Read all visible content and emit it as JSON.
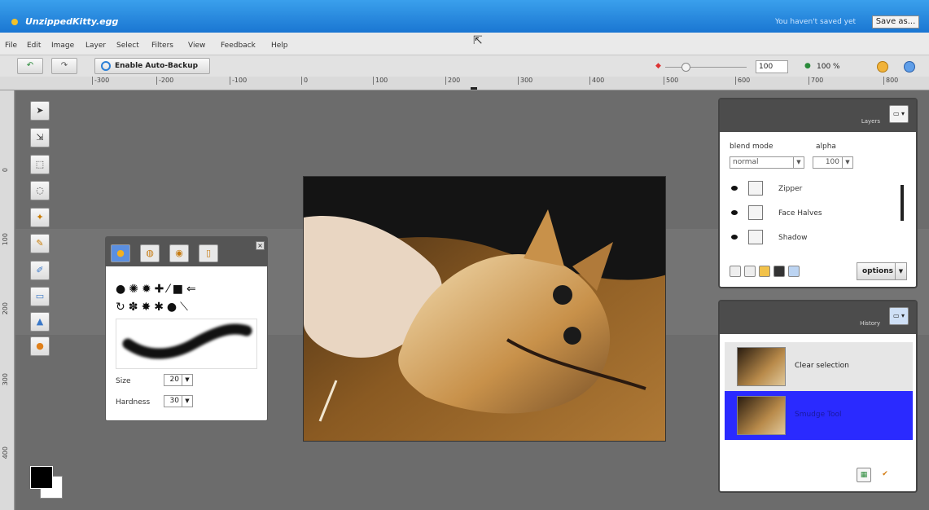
{
  "titlebar": {
    "title": "UnzippedKitty.egg",
    "not_saved": "You haven't saved yet",
    "save_as": "Save as..."
  },
  "menu": [
    "File",
    "Edit",
    "Image",
    "Layer",
    "Select",
    "Filters",
    "View",
    "Feedback",
    "Help"
  ],
  "toolbar": {
    "undo_icon": "undo-icon",
    "redo_icon": "redo-icon",
    "auto_backup": "Enable Auto-Backup",
    "zoom_value": "100",
    "zoom_percent": "100 %"
  },
  "ruler": {
    "top_ticks": [
      "-300",
      "-200",
      "-100",
      "0",
      "100",
      "200",
      "300",
      "400",
      "500",
      "600",
      "700",
      "800"
    ],
    "left_ticks": [
      "0",
      "100",
      "200",
      "300",
      "400"
    ]
  },
  "tools": [
    "move-icon",
    "pointer-icon",
    "marquee-icon",
    "lasso-icon",
    "wand-icon",
    "pencil-icon",
    "brush-icon",
    "eraser-icon",
    "fill-icon",
    "gradient-icon"
  ],
  "brush_panel": {
    "size_label": "Size",
    "size_value": "20",
    "hardness_label": "Hardness",
    "hardness_value": "30"
  },
  "layers": {
    "title": "Layers",
    "blend_label": "blend mode",
    "alpha_label": "alpha",
    "blend_value": "normal",
    "alpha_value": "100",
    "items": [
      {
        "name": "Zipper"
      },
      {
        "name": "Face Halves"
      },
      {
        "name": "Shadow"
      }
    ],
    "options_label": "options"
  },
  "history": {
    "title": "History",
    "items": [
      {
        "name": "Clear selection"
      },
      {
        "name": "Smudge Tool"
      }
    ]
  },
  "colors": {
    "titlebar": "#1a76d2",
    "history_selected": "#2a2aff",
    "foreground": "#000000",
    "background": "#ffffff"
  }
}
